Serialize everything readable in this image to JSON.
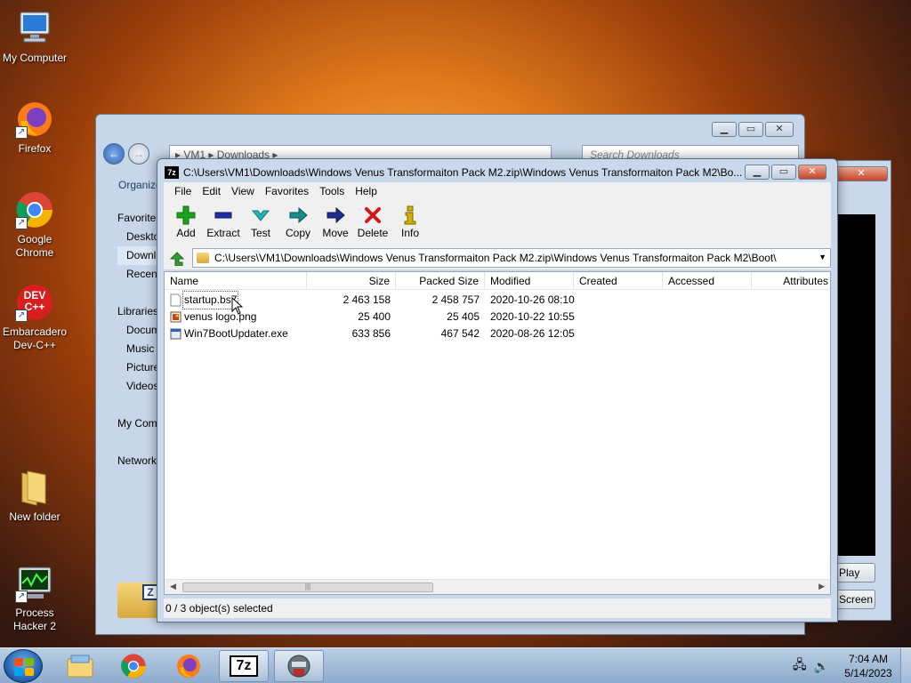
{
  "desktop": {
    "icons": [
      {
        "label": "My Computer",
        "icon": "computer-icon"
      },
      {
        "label": "Firefox",
        "icon": "firefox-icon"
      },
      {
        "label": "Google Chrome",
        "icon": "chrome-icon"
      },
      {
        "label": "Embarcadero Dev-C++",
        "icon": "devcpp-icon",
        "badge": "DEV C++"
      },
      {
        "label": "New folder",
        "icon": "folder-icon"
      },
      {
        "label": "Process Hacker 2",
        "icon": "process-hacker-icon"
      }
    ]
  },
  "explorer": {
    "breadcrumb": "▸ VM1 ▸ Downloads ▸",
    "search_placeholder": "Search Downloads",
    "organize": "Organize",
    "sidebar": [
      "Favorites",
      "Desktop",
      "Downloads",
      "Recent Places",
      "",
      "Libraries",
      "Documents",
      "Music",
      "Pictures",
      "Videos",
      "",
      "My Computer",
      "",
      "Network"
    ]
  },
  "background_panel": {
    "buttons": [
      "Play",
      "Screen"
    ]
  },
  "sevenzip": {
    "logo": "7z",
    "title": "C:\\Users\\VM1\\Downloads\\Windows Venus Transformaiton Pack M2.zip\\Windows Venus Transformaiton Pack M2\\Bo...",
    "menu": [
      "File",
      "Edit",
      "View",
      "Favorites",
      "Tools",
      "Help"
    ],
    "toolbar": [
      {
        "label": "Add",
        "icon": "plus-icon",
        "color": "#1aa31a"
      },
      {
        "label": "Extract",
        "icon": "minus-icon",
        "color": "#1c2fa8"
      },
      {
        "label": "Test",
        "icon": "check-icon",
        "color": "#26b5b5"
      },
      {
        "label": "Copy",
        "icon": "arrow-right-icon",
        "color": "#1a8a8a"
      },
      {
        "label": "Move",
        "icon": "arrow-right-icon",
        "color": "#1c2f8a"
      },
      {
        "label": "Delete",
        "icon": "x-icon",
        "color": "#d01818"
      },
      {
        "label": "Info",
        "icon": "info-icon",
        "color": "#d6b000"
      }
    ],
    "path": "C:\\Users\\VM1\\Downloads\\Windows Venus Transformaiton Pack M2.zip\\Windows Venus Transformaiton Pack M2\\Boot\\",
    "columns": [
      "Name",
      "Size",
      "Packed Size",
      "Modified",
      "Created",
      "Accessed",
      "Attributes"
    ],
    "files": [
      {
        "name": "startup.bs7",
        "size": "2 463 158",
        "packed": "2 458 757",
        "modified": "2020-10-26 08:10",
        "icon": "blank-file-icon"
      },
      {
        "name": "venus logo.png",
        "size": "25 400",
        "packed": "25 405",
        "modified": "2020-10-22 10:55",
        "icon": "image-file-icon"
      },
      {
        "name": "Win7BootUpdater.exe",
        "size": "633 856",
        "packed": "467 542",
        "modified": "2020-08-26 12:05",
        "icon": "exe-file-icon"
      }
    ],
    "status": "0 / 3 object(s) selected"
  },
  "taskbar": {
    "apps": [
      "explorer-icon",
      "chrome-icon",
      "firefox-icon",
      "7zip-icon",
      "process-icon"
    ],
    "active_app": "7z",
    "time": "7:04 AM",
    "date": "5/14/2023"
  }
}
